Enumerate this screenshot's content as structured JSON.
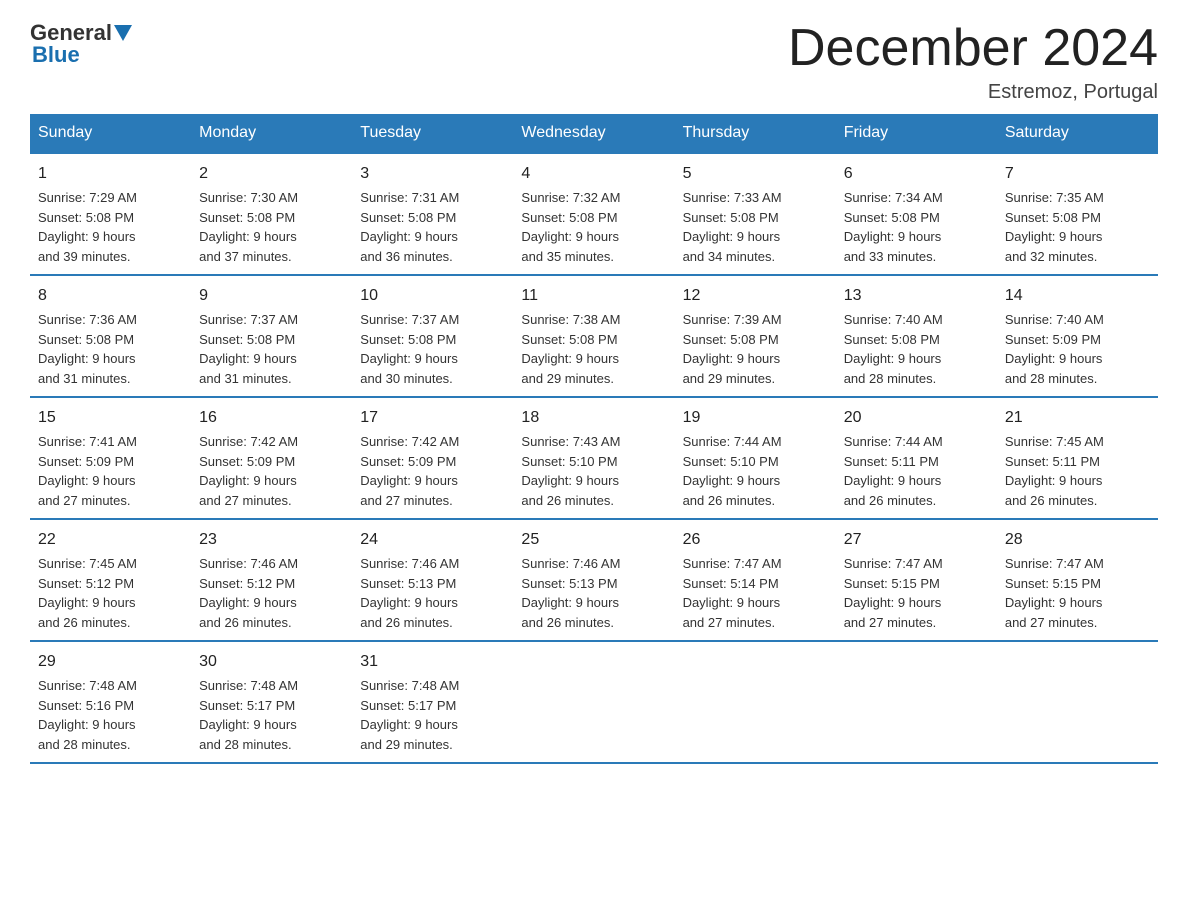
{
  "header": {
    "logo_top": "General",
    "logo_bottom": "Blue",
    "month_title": "December 2024",
    "location": "Estremoz, Portugal"
  },
  "columns": [
    "Sunday",
    "Monday",
    "Tuesday",
    "Wednesday",
    "Thursday",
    "Friday",
    "Saturday"
  ],
  "weeks": [
    [
      {
        "day": "1",
        "sunrise": "7:29 AM",
        "sunset": "5:08 PM",
        "daylight": "9 hours and 39 minutes."
      },
      {
        "day": "2",
        "sunrise": "7:30 AM",
        "sunset": "5:08 PM",
        "daylight": "9 hours and 37 minutes."
      },
      {
        "day": "3",
        "sunrise": "7:31 AM",
        "sunset": "5:08 PM",
        "daylight": "9 hours and 36 minutes."
      },
      {
        "day": "4",
        "sunrise": "7:32 AM",
        "sunset": "5:08 PM",
        "daylight": "9 hours and 35 minutes."
      },
      {
        "day": "5",
        "sunrise": "7:33 AM",
        "sunset": "5:08 PM",
        "daylight": "9 hours and 34 minutes."
      },
      {
        "day": "6",
        "sunrise": "7:34 AM",
        "sunset": "5:08 PM",
        "daylight": "9 hours and 33 minutes."
      },
      {
        "day": "7",
        "sunrise": "7:35 AM",
        "sunset": "5:08 PM",
        "daylight": "9 hours and 32 minutes."
      }
    ],
    [
      {
        "day": "8",
        "sunrise": "7:36 AM",
        "sunset": "5:08 PM",
        "daylight": "9 hours and 31 minutes."
      },
      {
        "day": "9",
        "sunrise": "7:37 AM",
        "sunset": "5:08 PM",
        "daylight": "9 hours and 31 minutes."
      },
      {
        "day": "10",
        "sunrise": "7:37 AM",
        "sunset": "5:08 PM",
        "daylight": "9 hours and 30 minutes."
      },
      {
        "day": "11",
        "sunrise": "7:38 AM",
        "sunset": "5:08 PM",
        "daylight": "9 hours and 29 minutes."
      },
      {
        "day": "12",
        "sunrise": "7:39 AM",
        "sunset": "5:08 PM",
        "daylight": "9 hours and 29 minutes."
      },
      {
        "day": "13",
        "sunrise": "7:40 AM",
        "sunset": "5:08 PM",
        "daylight": "9 hours and 28 minutes."
      },
      {
        "day": "14",
        "sunrise": "7:40 AM",
        "sunset": "5:09 PM",
        "daylight": "9 hours and 28 minutes."
      }
    ],
    [
      {
        "day": "15",
        "sunrise": "7:41 AM",
        "sunset": "5:09 PM",
        "daylight": "9 hours and 27 minutes."
      },
      {
        "day": "16",
        "sunrise": "7:42 AM",
        "sunset": "5:09 PM",
        "daylight": "9 hours and 27 minutes."
      },
      {
        "day": "17",
        "sunrise": "7:42 AM",
        "sunset": "5:09 PM",
        "daylight": "9 hours and 27 minutes."
      },
      {
        "day": "18",
        "sunrise": "7:43 AM",
        "sunset": "5:10 PM",
        "daylight": "9 hours and 26 minutes."
      },
      {
        "day": "19",
        "sunrise": "7:44 AM",
        "sunset": "5:10 PM",
        "daylight": "9 hours and 26 minutes."
      },
      {
        "day": "20",
        "sunrise": "7:44 AM",
        "sunset": "5:11 PM",
        "daylight": "9 hours and 26 minutes."
      },
      {
        "day": "21",
        "sunrise": "7:45 AM",
        "sunset": "5:11 PM",
        "daylight": "9 hours and 26 minutes."
      }
    ],
    [
      {
        "day": "22",
        "sunrise": "7:45 AM",
        "sunset": "5:12 PM",
        "daylight": "9 hours and 26 minutes."
      },
      {
        "day": "23",
        "sunrise": "7:46 AM",
        "sunset": "5:12 PM",
        "daylight": "9 hours and 26 minutes."
      },
      {
        "day": "24",
        "sunrise": "7:46 AM",
        "sunset": "5:13 PM",
        "daylight": "9 hours and 26 minutes."
      },
      {
        "day": "25",
        "sunrise": "7:46 AM",
        "sunset": "5:13 PM",
        "daylight": "9 hours and 26 minutes."
      },
      {
        "day": "26",
        "sunrise": "7:47 AM",
        "sunset": "5:14 PM",
        "daylight": "9 hours and 27 minutes."
      },
      {
        "day": "27",
        "sunrise": "7:47 AM",
        "sunset": "5:15 PM",
        "daylight": "9 hours and 27 minutes."
      },
      {
        "day": "28",
        "sunrise": "7:47 AM",
        "sunset": "5:15 PM",
        "daylight": "9 hours and 27 minutes."
      }
    ],
    [
      {
        "day": "29",
        "sunrise": "7:48 AM",
        "sunset": "5:16 PM",
        "daylight": "9 hours and 28 minutes."
      },
      {
        "day": "30",
        "sunrise": "7:48 AM",
        "sunset": "5:17 PM",
        "daylight": "9 hours and 28 minutes."
      },
      {
        "day": "31",
        "sunrise": "7:48 AM",
        "sunset": "5:17 PM",
        "daylight": "9 hours and 29 minutes."
      },
      {
        "day": "",
        "sunrise": "",
        "sunset": "",
        "daylight": ""
      },
      {
        "day": "",
        "sunrise": "",
        "sunset": "",
        "daylight": ""
      },
      {
        "day": "",
        "sunrise": "",
        "sunset": "",
        "daylight": ""
      },
      {
        "day": "",
        "sunrise": "",
        "sunset": "",
        "daylight": ""
      }
    ]
  ],
  "labels": {
    "sunrise": "Sunrise:",
    "sunset": "Sunset:",
    "daylight": "Daylight:"
  }
}
